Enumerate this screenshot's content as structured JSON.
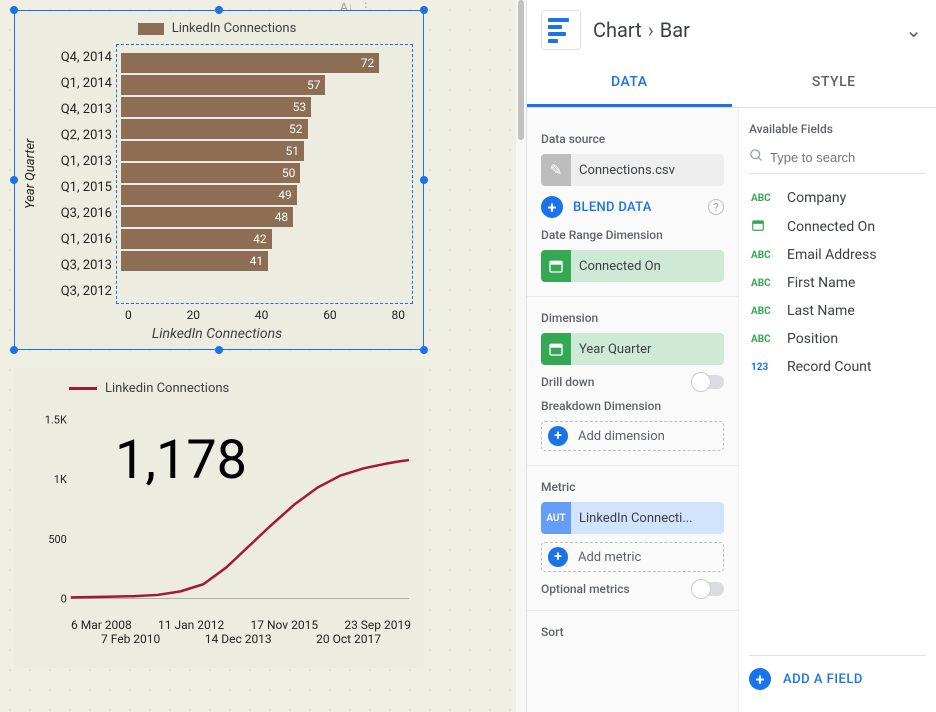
{
  "header": {
    "crumb1": "Chart",
    "crumb2": "Bar"
  },
  "tabs": {
    "data": "DATA",
    "style": "STYLE"
  },
  "dataPanel": {
    "dataSourceLabel": "Data source",
    "dataSource": "Connections.csv",
    "blend": "BLEND DATA",
    "dateRangeLabel": "Date Range Dimension",
    "dateRange": "Connected On",
    "dimensionLabel": "Dimension",
    "dimension": "Year Quarter",
    "drillDownLabel": "Drill down",
    "breakdownLabel": "Breakdown Dimension",
    "addDimension": "Add dimension",
    "metricLabel": "Metric",
    "metricType": "AUT",
    "metric": "LinkedIn Connecti...",
    "addMetric": "Add metric",
    "optionalMetricsLabel": "Optional metrics",
    "sortLabel": "Sort"
  },
  "fieldsPanel": {
    "title": "Available Fields",
    "searchPlaceholder": "Type to search",
    "fields": [
      {
        "type": "abc",
        "name": "Company"
      },
      {
        "type": "date",
        "name": "Connected On"
      },
      {
        "type": "abc",
        "name": "Email Address"
      },
      {
        "type": "abc",
        "name": "First Name"
      },
      {
        "type": "abc",
        "name": "Last Name"
      },
      {
        "type": "abc",
        "name": "Position"
      },
      {
        "type": "num",
        "name": "Record Count"
      }
    ],
    "addField": "ADD A FIELD"
  },
  "chart_data": [
    {
      "type": "bar",
      "title": "LinkedIn Connections",
      "ylabel": "Year Quarter",
      "xlabel": "LinkedIn Connections",
      "xticks": [
        0,
        20,
        40,
        60,
        80
      ],
      "xlim": [
        0,
        80
      ],
      "categories": [
        "Q4, 2014",
        "Q1, 2014",
        "Q4, 2013",
        "Q2, 2013",
        "Q1, 2013",
        "Q1, 2015",
        "Q3, 2016",
        "Q1, 2016",
        "Q3, 2013",
        "Q3, 2012"
      ],
      "values": [
        72,
        57,
        53,
        52,
        51,
        50,
        49,
        48,
        42,
        41
      ]
    },
    {
      "type": "line",
      "title": "Linkedin Connections",
      "scorecard": "1,178",
      "yticks": [
        "1.5K",
        "1K",
        "500",
        "0"
      ],
      "ylim": [
        0,
        1500
      ],
      "xticks_row1": [
        "6 Mar 2008",
        "11 Jan 2012",
        "17 Nov 2015",
        "23 Sep 2019"
      ],
      "xticks_row2": [
        "7 Feb 2010",
        "14 Dec 2013",
        "20 Oct 2017"
      ],
      "points": [
        [
          0,
          10
        ],
        [
          40,
          15
        ],
        [
          70,
          20
        ],
        [
          95,
          30
        ],
        [
          120,
          60
        ],
        [
          145,
          120
        ],
        [
          170,
          260
        ],
        [
          195,
          440
        ],
        [
          220,
          620
        ],
        [
          245,
          790
        ],
        [
          270,
          930
        ],
        [
          295,
          1030
        ],
        [
          320,
          1090
        ],
        [
          345,
          1130
        ],
        [
          360,
          1150
        ],
        [
          370,
          1160
        ]
      ]
    }
  ]
}
